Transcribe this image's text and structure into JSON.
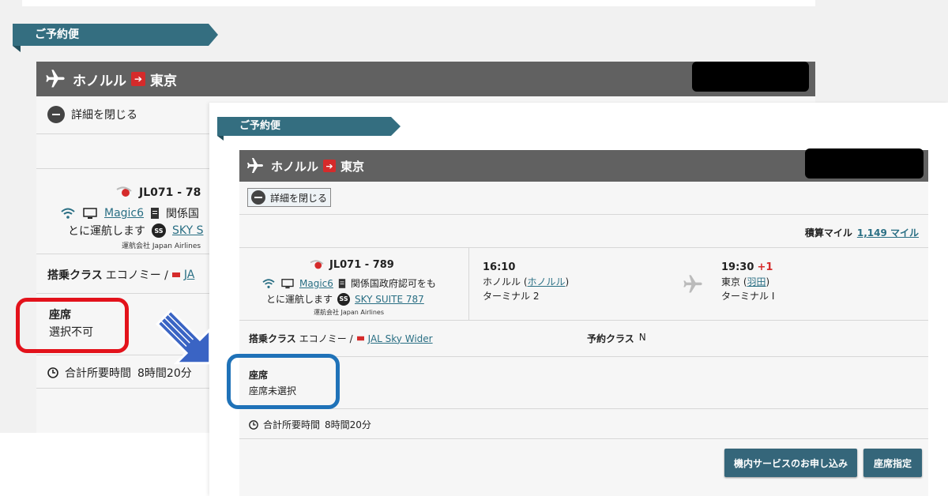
{
  "section_label": "ご予約便",
  "route": {
    "origin": "ホノルル",
    "destination": "東京"
  },
  "details_toggle": "詳細を閉じる",
  "mileage": {
    "label": "積算マイル",
    "value": "1,149 マイル"
  },
  "flight": {
    "number": "JL071 - 789",
    "entertainment": "Magic6",
    "note_line1": "関係国政府認可をも",
    "note_line2": "とに運航します",
    "aircraft": "SKY SUITE 787",
    "operator": "運航会社 Japan Airlines"
  },
  "departure": {
    "time": "16:10",
    "city": "ホノルル",
    "airport": "ホノルル",
    "terminal": "ターミナル 2"
  },
  "arrival": {
    "time": "19:30",
    "day_offset": "+1",
    "city": "東京",
    "airport": "羽田",
    "terminal": "ターミナル I"
  },
  "cabin": {
    "label": "搭乗クラス",
    "value": "エコノミー / ",
    "product": "JAL Sky Wider"
  },
  "booking_class": {
    "label": "予約クラス",
    "value": "N"
  },
  "seat": {
    "label": "座席",
    "before_value": "選択不可",
    "after_value": "座席未選択"
  },
  "total_time": {
    "label": "合計所要時間",
    "value": "8時間20分"
  },
  "before_partial": {
    "flight_number": "JL071 - 78",
    "note_line1": "関係国",
    "aircraft": "SKY S",
    "operator": "運航会社 Japan Airlines",
    "cabin_product": "JA",
    "total_time": "8時間20分"
  },
  "buttons": {
    "inflight_service": "機内サービスのお申し込み",
    "seat_select": "座席指定"
  },
  "colors": {
    "ribbon": "#346e80",
    "route_bar": "#616161",
    "button": "#35667a",
    "highlight_red": "#e3121b",
    "highlight_blue": "#1f72b8",
    "arrow_blue": "#3a64c4"
  }
}
